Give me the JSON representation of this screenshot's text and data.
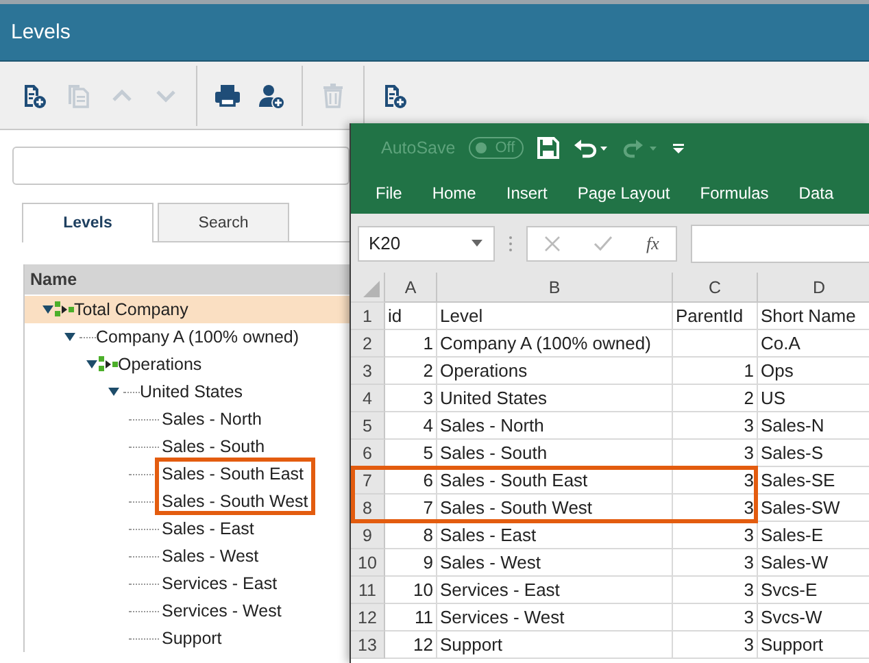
{
  "window": {
    "title": "Levels"
  },
  "toolbar": [
    {
      "kind": "document-plus",
      "disabled": false
    },
    {
      "kind": "copy",
      "disabled": true
    },
    {
      "kind": "move-up",
      "disabled": true
    },
    {
      "kind": "move-down",
      "disabled": true
    },
    {
      "kind": "separator"
    },
    {
      "kind": "print",
      "disabled": false
    },
    {
      "kind": "add-user",
      "disabled": false
    },
    {
      "kind": "separator"
    },
    {
      "kind": "delete",
      "disabled": true
    },
    {
      "kind": "separator"
    },
    {
      "kind": "document-plus",
      "disabled": false
    }
  ],
  "tabs": [
    {
      "label": "Levels",
      "selected": true
    },
    {
      "label": "Search",
      "selected": false
    }
  ],
  "tree": {
    "header": "Name",
    "items": [
      {
        "label": "Total Company",
        "kind": "rollup",
        "expanded": true,
        "selected": true,
        "highlighted": false,
        "children": [
          {
            "label": "Company A (100% owned)",
            "kind": "node",
            "expanded": true,
            "selected": false,
            "highlighted": false,
            "children": [
              {
                "label": "Operations",
                "kind": "rollup",
                "expanded": true,
                "selected": false,
                "highlighted": false,
                "children": [
                  {
                    "label": "United States",
                    "kind": "node",
                    "expanded": true,
                    "selected": false,
                    "highlighted": false,
                    "children": [
                      {
                        "label": "Sales - North",
                        "kind": "leaf",
                        "selected": false,
                        "highlighted": false
                      },
                      {
                        "label": "Sales - South",
                        "kind": "leaf",
                        "selected": false,
                        "highlighted": false
                      },
                      {
                        "label": "Sales - South East",
                        "kind": "leaf",
                        "selected": false,
                        "highlighted": true
                      },
                      {
                        "label": "Sales - South West",
                        "kind": "leaf",
                        "selected": false,
                        "highlighted": true
                      },
                      {
                        "label": "Sales - East",
                        "kind": "leaf",
                        "selected": false,
                        "highlighted": false
                      },
                      {
                        "label": "Sales - West",
                        "kind": "leaf",
                        "selected": false,
                        "highlighted": false
                      },
                      {
                        "label": "Services - East",
                        "kind": "leaf",
                        "selected": false,
                        "highlighted": false
                      },
                      {
                        "label": "Services - West",
                        "kind": "leaf",
                        "selected": false,
                        "highlighted": false
                      },
                      {
                        "label": "Support",
                        "kind": "leaf",
                        "selected": false,
                        "highlighted": false
                      }
                    ]
                  }
                ]
              }
            ]
          }
        ]
      }
    ]
  },
  "spreadsheet": {
    "autosave": {
      "label": "AutoSave",
      "on": false,
      "state_text": "Off"
    },
    "quick_access": [
      {
        "kind": "save",
        "disabled": false
      },
      {
        "kind": "undo",
        "disabled": false
      },
      {
        "kind": "redo",
        "disabled": true
      },
      {
        "kind": "customize",
        "disabled": false
      }
    ],
    "ribbon_tabs": [
      "File",
      "Home",
      "Insert",
      "Page Layout",
      "Formulas",
      "Data"
    ],
    "name_box": "K20",
    "function_label": "fx",
    "columns": [
      "A",
      "B",
      "C",
      "D"
    ],
    "rows": [
      {
        "number": "1",
        "highlighted": false,
        "cells": {
          "A": "id",
          "B": "Level",
          "C": "ParentId",
          "D": "Short Name"
        }
      },
      {
        "number": "2",
        "highlighted": false,
        "cells": {
          "A": "1",
          "B": "Company A (100% owned)",
          "D": "Co.A"
        }
      },
      {
        "number": "3",
        "highlighted": false,
        "cells": {
          "A": "2",
          "B": "Operations",
          "C": "1",
          "D": "Ops"
        }
      },
      {
        "number": "4",
        "highlighted": false,
        "cells": {
          "A": "3",
          "B": "United States",
          "C": "2",
          "D": "US"
        }
      },
      {
        "number": "5",
        "highlighted": false,
        "cells": {
          "A": "4",
          "B": "Sales - North",
          "C": "3",
          "D": "Sales-N"
        }
      },
      {
        "number": "6",
        "highlighted": false,
        "cells": {
          "A": "5",
          "B": "Sales - South",
          "C": "3",
          "D": "Sales-S"
        }
      },
      {
        "number": "7",
        "highlighted": true,
        "cells": {
          "A": "6",
          "B": "Sales - South East",
          "C": "3",
          "D": "Sales-SE"
        }
      },
      {
        "number": "8",
        "highlighted": true,
        "cells": {
          "A": "7",
          "B": "Sales - South West",
          "C": "3",
          "D": "Sales-SW"
        }
      },
      {
        "number": "9",
        "highlighted": false,
        "cells": {
          "A": "8",
          "B": "Sales - East",
          "C": "3",
          "D": "Sales-E"
        }
      },
      {
        "number": "10",
        "highlighted": false,
        "cells": {
          "A": "9",
          "B": "Sales - West",
          "C": "3",
          "D": "Sales-W"
        }
      },
      {
        "number": "11",
        "highlighted": false,
        "cells": {
          "A": "10",
          "B": "Services - East",
          "C": "3",
          "D": "Svcs-E"
        }
      },
      {
        "number": "12",
        "highlighted": false,
        "cells": {
          "A": "11",
          "B": "Services - West",
          "C": "3",
          "D": "Svcs-W"
        }
      },
      {
        "number": "13",
        "highlighted": false,
        "cells": {
          "A": "12",
          "B": "Support",
          "C": "3",
          "D": "Support"
        }
      }
    ]
  }
}
